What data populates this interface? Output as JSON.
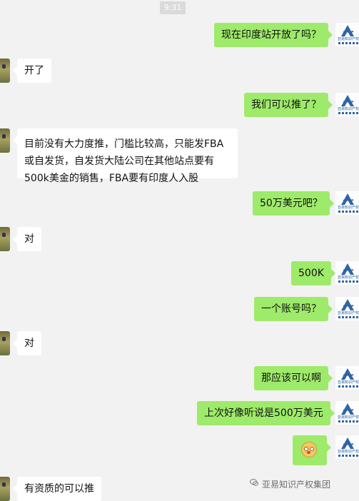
{
  "time_label": "9:31",
  "brand": {
    "avatar_caption": "亚易知识产权",
    "accent": "#2f65a7"
  },
  "messages": [
    {
      "side": "out",
      "text": "现在印度站开放了吗？"
    },
    {
      "side": "in",
      "text": "开了"
    },
    {
      "side": "out",
      "text": "我们可以推了？"
    },
    {
      "side": "in",
      "text": "目前没有大力度推，门槛比较高，只能发FBA或自发货，自发货大陆公司在其他站点要有500k美金的销售，FBA要有印度人入股"
    },
    {
      "side": "out",
      "text": "50万美元吧？"
    },
    {
      "side": "in",
      "text": "对"
    },
    {
      "side": "out",
      "text": "500K"
    },
    {
      "side": "out",
      "text": "一个账号吗？"
    },
    {
      "side": "in",
      "text": "对"
    },
    {
      "side": "out",
      "text": "那应该可以啊"
    },
    {
      "side": "out",
      "text": "上次好像听说是500万美元"
    },
    {
      "side": "out",
      "emoji": "flushed-face-emoji"
    },
    {
      "side": "in",
      "text": "有资质的可以推"
    }
  ],
  "watermark": "亚易知识产权集团",
  "colors": {
    "background": "#f2f2f2",
    "outgoing_bubble": "#9eea6a",
    "incoming_bubble": "#ffffff"
  }
}
